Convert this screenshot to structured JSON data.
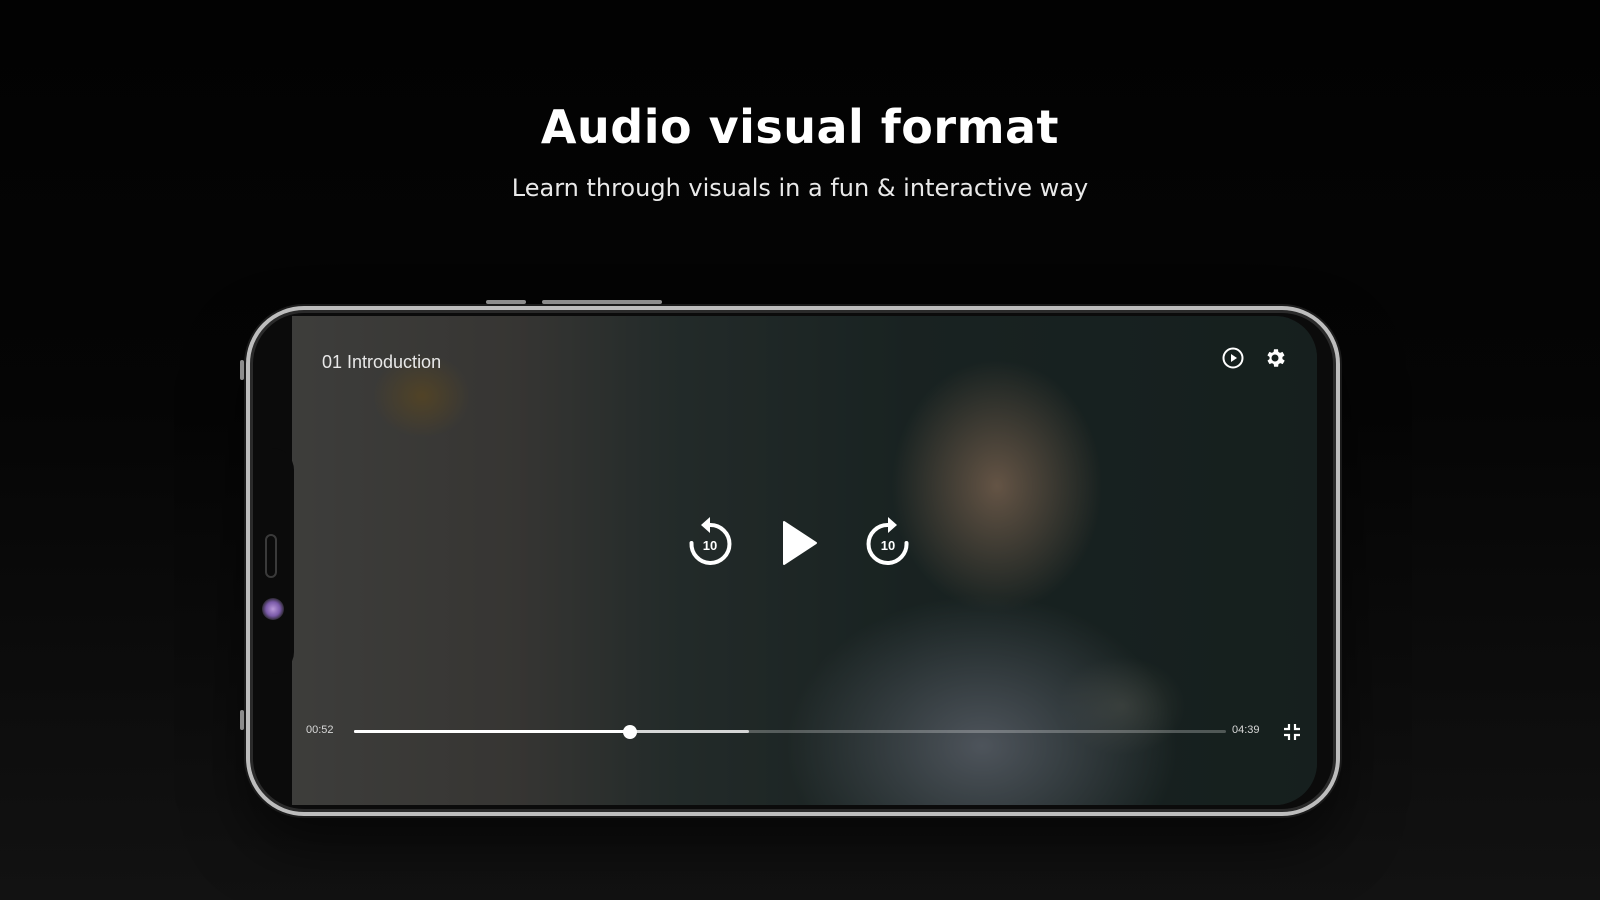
{
  "promo": {
    "headline": "Audio visual format",
    "subline": "Learn through visuals in a fun & interactive way"
  },
  "player": {
    "title": "01 Introduction",
    "current_time": "00:52",
    "total_time": "04:39",
    "played_fraction": 0.317,
    "buffered_fraction": 0.453,
    "rewind_seconds": "10",
    "forward_seconds": "10",
    "icons": {
      "playback_speed": "play-circle-icon",
      "settings": "gear-icon",
      "rewind": "rewind-10-icon",
      "play": "play-icon",
      "forward": "forward-10-icon",
      "fullscreen": "exit-fullscreen-icon"
    }
  },
  "colors": {
    "background": "#000000",
    "text": "#ffffff",
    "frame": "#bdbdbd",
    "camera_accent": "#b898d8"
  }
}
